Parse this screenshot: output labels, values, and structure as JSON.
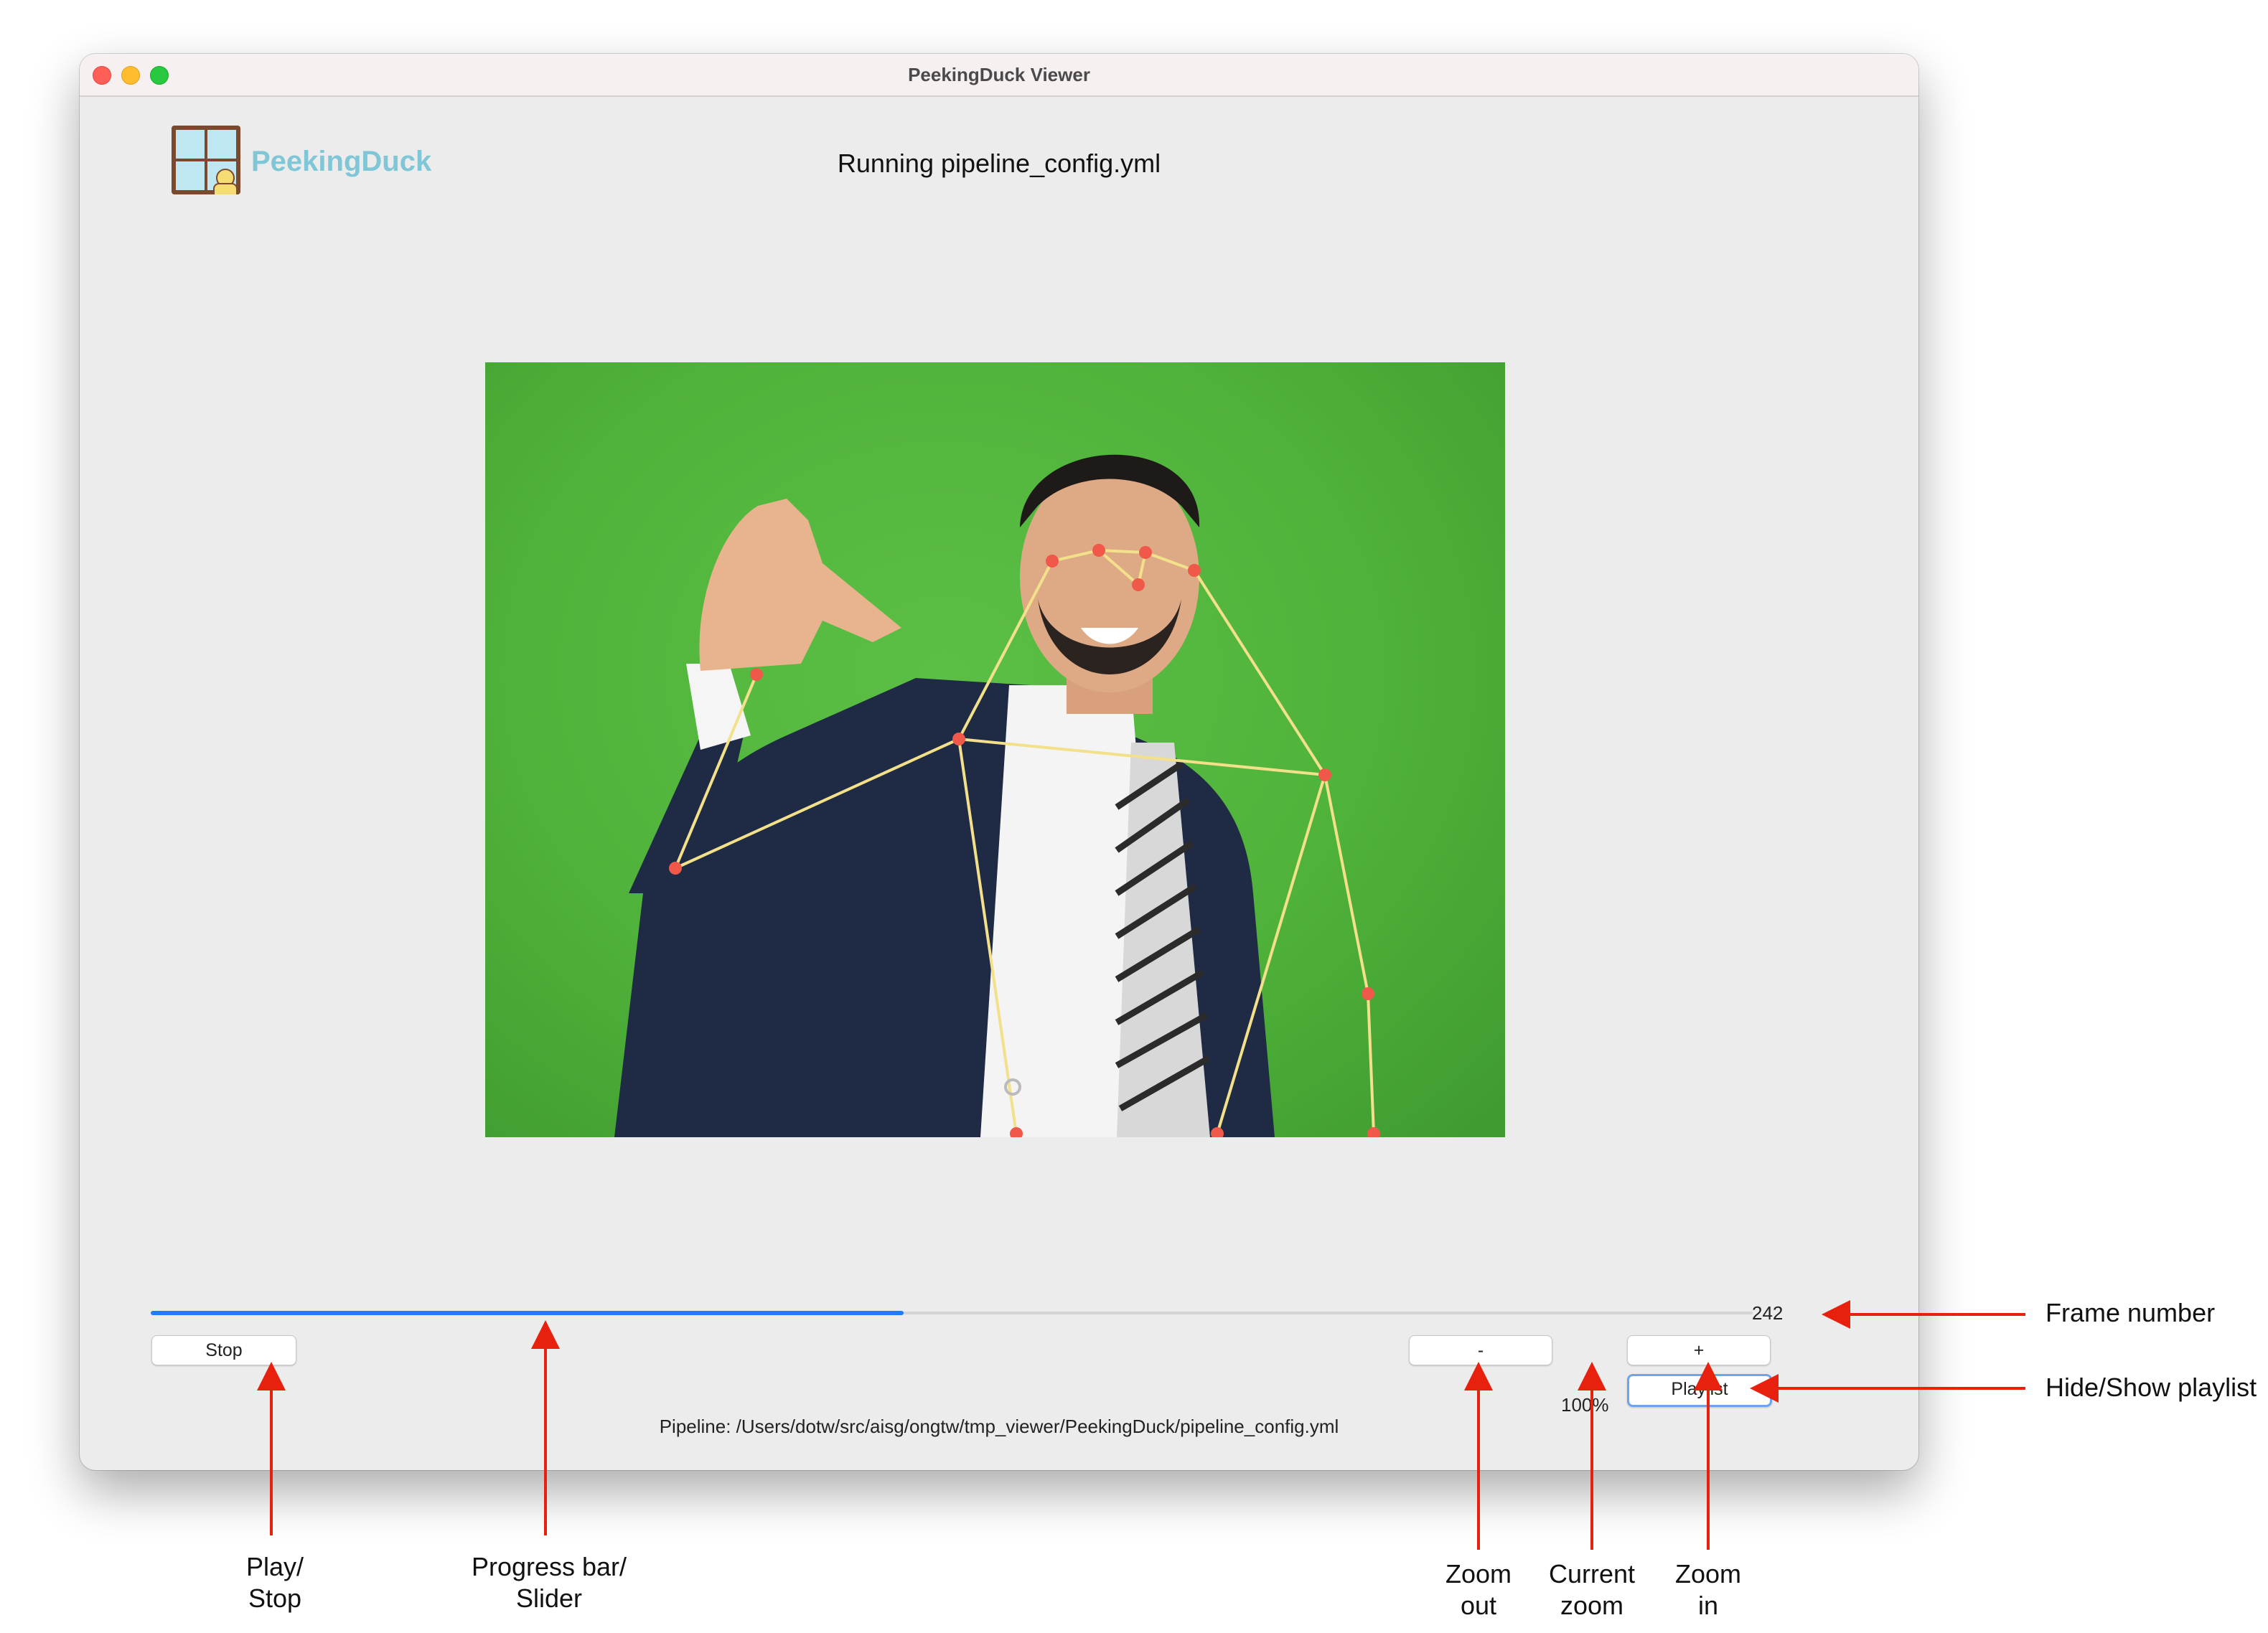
{
  "window": {
    "title": "PeekingDuck Viewer"
  },
  "header": {
    "logo_text": "PeekingDuck",
    "running_title": "Running pipeline_config.yml"
  },
  "player": {
    "progress_fraction": 0.47,
    "frame_number": "242",
    "stop_label": "Stop",
    "zoom_out_label": "-",
    "zoom_value": "100%",
    "zoom_in_label": "+",
    "playlist_label": "Playlist",
    "pipeline_path": "Pipeline: /Users/dotw/src/aisg/ongtw/tmp_viewer/PeekingDuck/pipeline_config.yml"
  },
  "annotations": {
    "frame_number": "Frame number",
    "hide_show_playlist": "Hide/Show playlist",
    "play_stop_1": "Play/",
    "play_stop_2": "Stop",
    "progress_1": "Progress bar/",
    "progress_2": "Slider",
    "zoom_out_1": "Zoom",
    "zoom_out_2": "out",
    "current_zoom_1": "Current",
    "current_zoom_2": "zoom",
    "zoom_in_1": "Zoom",
    "zoom_in_2": "in"
  },
  "colors": {
    "accent": "#1f7bff",
    "annotation_arrow": "#e8210f",
    "keypoint": "#f0584a",
    "skeleton": "#f3e08a",
    "background_green": "#52b63c"
  },
  "icons": {
    "logo": "duck-window-logo-icon"
  }
}
